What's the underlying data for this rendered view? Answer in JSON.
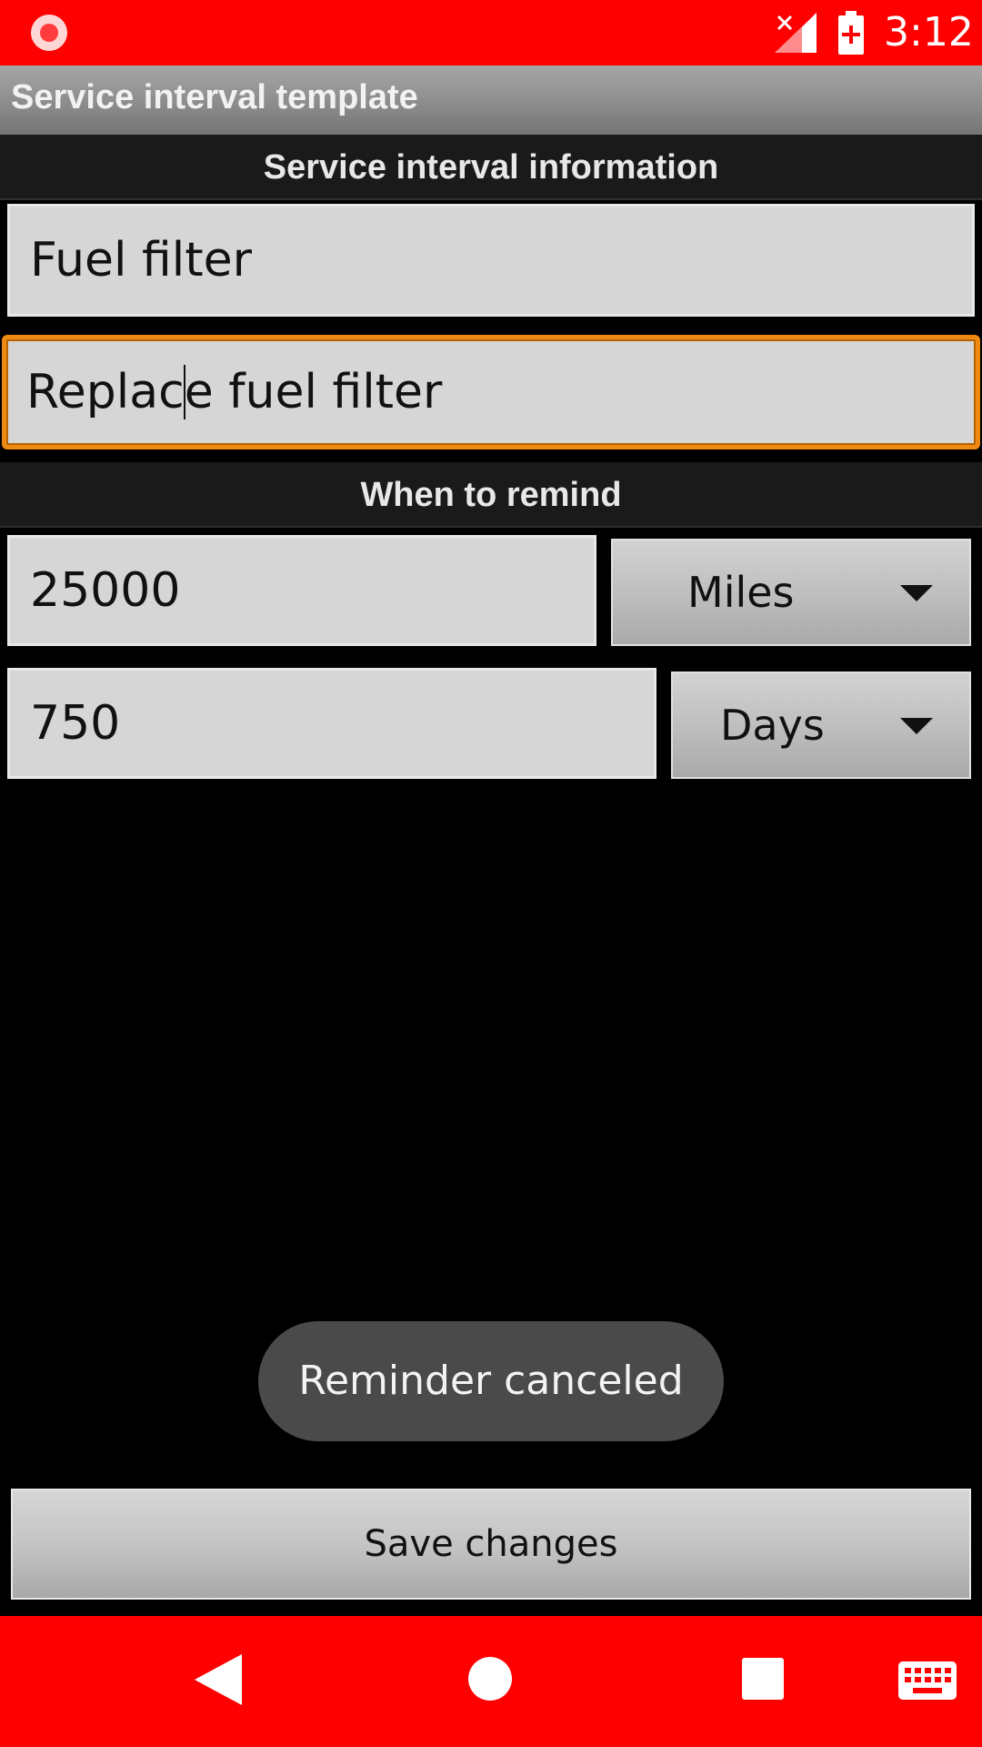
{
  "status_bar": {
    "time": "3:12",
    "icons": [
      "screen-record-icon",
      "signal-no-service-icon",
      "battery-charging-icon"
    ]
  },
  "title_bar": {
    "title": "Service interval template"
  },
  "info_section": {
    "header": "Service interval information",
    "name_value": "Fuel filter",
    "description_value_before_cursor": "Replac",
    "description_value_after_cursor": "e fuel filter"
  },
  "remind_section": {
    "header": "When to remind",
    "distance_value": "25000",
    "distance_unit": "Miles",
    "time_value": "750",
    "time_unit": "Days"
  },
  "toast": {
    "message": "Reminder canceled"
  },
  "actions": {
    "save_label": "Save changes"
  },
  "nav_bar": {
    "icons": [
      "back-icon",
      "home-icon",
      "recents-icon",
      "keyboard-icon"
    ]
  },
  "colors": {
    "system_bar": "#ff0000",
    "focus_border": "#ee8a14",
    "background": "#000000",
    "field_background": "#d6d6d6"
  }
}
